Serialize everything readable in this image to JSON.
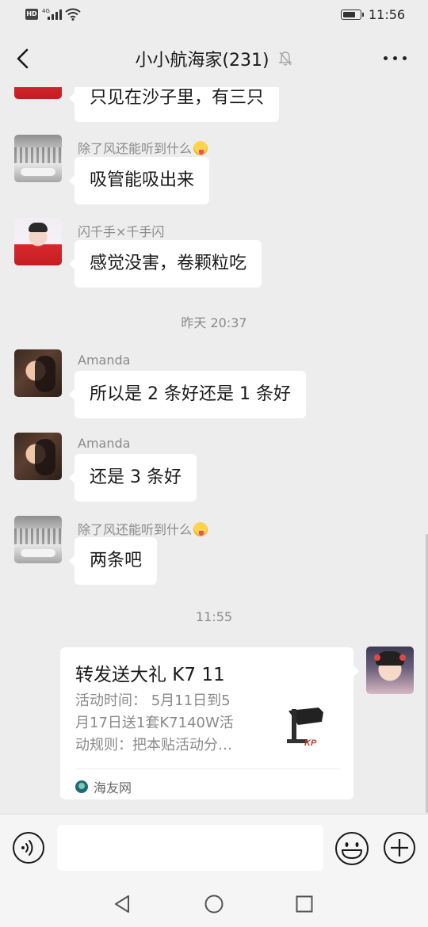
{
  "status_bar": {
    "hd_label": "HD",
    "network": "4G",
    "time": "11:56",
    "battery_level": 0.8
  },
  "header": {
    "title": "小小航海家(231)",
    "icons": [
      "back-icon",
      "mute-bell-icon",
      "more-icon"
    ]
  },
  "messages": [
    {
      "type": "text",
      "sender": "",
      "avatar": "red-shirt-avatar",
      "text": "只见在沙子里，有三只"
    },
    {
      "type": "text",
      "sender": "除了风还能听到什么",
      "sender_emoji": "tongue-emoji",
      "avatar": "snow-avatar",
      "text": "吸管能吸出来"
    },
    {
      "type": "text",
      "sender": "闪千手×千手闪",
      "avatar": "red-shirt-avatar",
      "text": "感觉没害，卷颗粒吃"
    },
    {
      "type": "timestamp",
      "text": "昨天 20:37"
    },
    {
      "type": "text",
      "sender": "Amanda",
      "avatar": "amanda-avatar",
      "text": "所以是 2 条好还是 1 条好"
    },
    {
      "type": "text",
      "sender": "Amanda",
      "avatar": "amanda-avatar",
      "text": "还是 3 条好"
    },
    {
      "type": "text",
      "sender": "除了风还能听到什么",
      "sender_emoji": "tongue-emoji",
      "avatar": "snow-avatar",
      "text": "两条吧"
    },
    {
      "type": "timestamp",
      "text": "11:55"
    },
    {
      "type": "link_card",
      "outgoing": true,
      "avatar": "girl-avatar",
      "title": "转发送大礼 K7 11",
      "desc_lines": [
        "活动时间：  5月11日到5",
        "月17日送1套K7140W活",
        "动规则：把本贴活动分…"
      ],
      "thumb_logo": "KP",
      "source": "海友网"
    }
  ],
  "input_bar": {
    "placeholder": "",
    "icons": [
      "voice-icon",
      "emoji-icon",
      "plus-icon"
    ]
  },
  "nav_bar": {
    "icons": [
      "nav-back-icon",
      "nav-home-icon",
      "nav-recent-icon"
    ]
  },
  "colors": {
    "background": "#ededed",
    "bubble": "#ffffff",
    "meta_text": "#8a8a8a"
  }
}
